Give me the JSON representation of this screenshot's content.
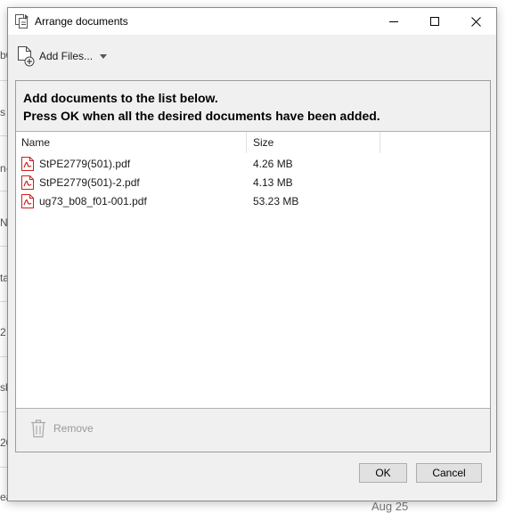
{
  "window": {
    "title": "Arrange documents"
  },
  "toolbar": {
    "add_files_label": "Add Files..."
  },
  "instructions": {
    "line1": "Add documents to the list below.",
    "line2": "Press OK when all the desired documents have been added."
  },
  "list": {
    "columns": [
      "Name",
      "Size"
    ],
    "files": [
      {
        "name": "StPE2779(501).pdf",
        "size": "4.26 MB",
        "icon": "pdf-icon"
      },
      {
        "name": "StPE2779(501)-2.pdf",
        "size": "4.13 MB",
        "icon": "pdf-icon"
      },
      {
        "name": "ug73_b08_f01-001.pdf",
        "size": "53.23 MB",
        "icon": "pdf-icon"
      }
    ]
  },
  "actions": {
    "remove_label": "Remove",
    "ok_label": "OK",
    "cancel_label": "Cancel"
  },
  "background": {
    "fragments": [
      "b0",
      "s",
      "n-",
      "N",
      "ta",
      "2",
      "sb",
      "20",
      "ea"
    ],
    "date": "Aug 25"
  },
  "colors": {
    "pdf_red": "#cc1f1f",
    "dialog_bg": "#f0f0f0",
    "list_bg": "#ffffff",
    "disabled_text": "#9a9a9a"
  }
}
